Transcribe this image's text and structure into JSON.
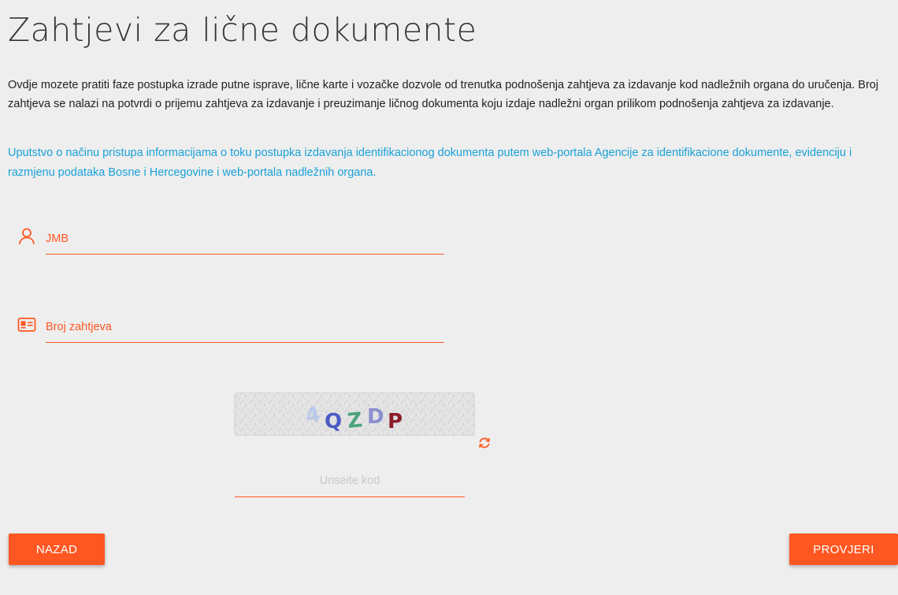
{
  "page": {
    "title": "Zahtjevi za lične dokumente",
    "intro": "Ovdje mozete pratiti faze postupka izrade putne isprave, lične karte i vozačke dozvole od trenutka podnošenja zahtjeva za izdavanje kod nadležnih organa do uručenja. Broj zahtjeva se nalazi na potvrdi o prijemu zahtjeva za izdavanje i preuzimanje ličnog dokumenta koju izdaje nadležni organ prilikom podnošenja zahtjeva za izdavanje.",
    "guide_link": "Uputstvo o načinu pristupa informacijama o toku postupka izdavanja identifikacionog dokumenta putem web-portala Agencije za identifikacione dokumente, evidenciju i razmjenu podataka Bosne i Hercegovine i web-portala nadležnih organa."
  },
  "form": {
    "jmb": {
      "placeholder": "JMB",
      "value": "",
      "icon": "user-icon"
    },
    "request_number": {
      "placeholder": "Broj zahtjeva",
      "value": "",
      "icon": "id-card-icon"
    },
    "captcha": {
      "text": "4QZDP",
      "characters": [
        "4",
        "Q",
        "Z",
        "D",
        "P"
      ],
      "colors": [
        "#b8c8e8",
        "#4a5bc4",
        "#49a37a",
        "#8b8fd0",
        "#8b1e2b"
      ],
      "refresh_icon": "refresh-icon",
      "code_placeholder": "Unseite kod",
      "code_value": ""
    }
  },
  "buttons": {
    "back_label": "NAZAD",
    "check_label": "PROVJERI"
  },
  "colors": {
    "accent": "#ff5722",
    "link": "#1aa1d8",
    "background": "#eeeeee"
  }
}
